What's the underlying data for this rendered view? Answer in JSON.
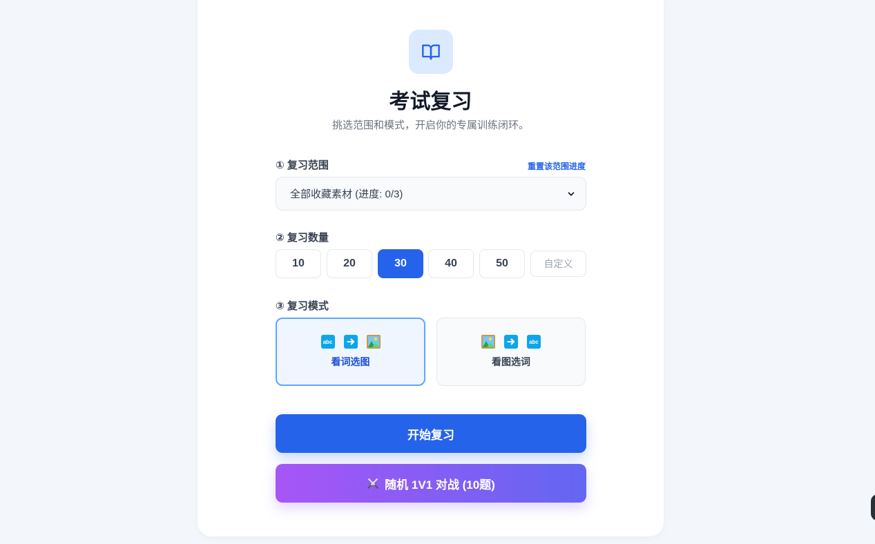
{
  "header": {
    "icon": "book-open-icon",
    "title": "考试复习",
    "subtitle": "挑选范围和模式，开启你的专属训练闭环。"
  },
  "scope": {
    "label": "① 复习范围",
    "reset_link": "重置该范围进度",
    "selected": "全部收藏素材 (进度: 0/3)"
  },
  "count": {
    "label": "② 复习数量",
    "options": [
      "10",
      "20",
      "30",
      "40",
      "50"
    ],
    "selected": "30",
    "custom_placeholder": "自定义"
  },
  "mode": {
    "label": "③ 复习模式",
    "options": [
      {
        "label": "看词选图",
        "icons": [
          "abc-icon",
          "arrow-right-icon",
          "picture-icon"
        ],
        "abc_text": "abc",
        "selected": true
      },
      {
        "label": "看图选词",
        "icons": [
          "picture-icon",
          "arrow-right-icon",
          "abc-icon"
        ],
        "abc_text": "abc",
        "selected": false
      }
    ]
  },
  "actions": {
    "start_label": "开始复习",
    "battle_label": "随机 1V1 对战 (10题)",
    "battle_icon": "crossed-swords-icon"
  },
  "colors": {
    "primary": "#2563eb",
    "icon_bg": "#dbeafe",
    "battle_gradient_start": "#a855f7",
    "battle_gradient_end": "#6366f1"
  }
}
